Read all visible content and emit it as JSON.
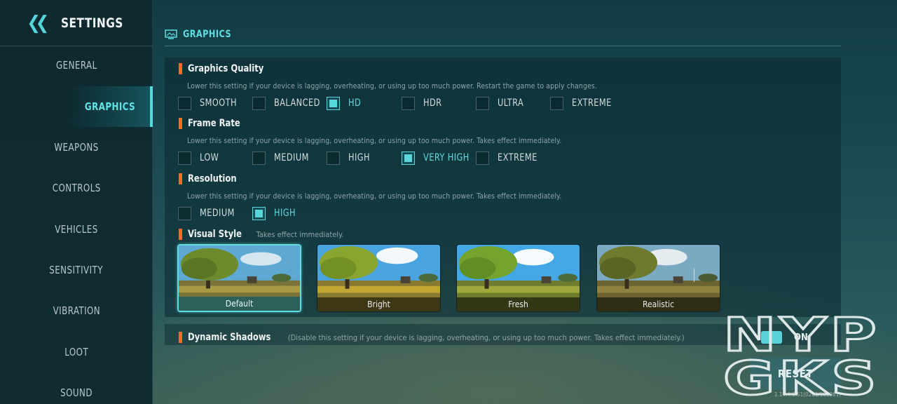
{
  "sidebar": {
    "title": "SETTINGS",
    "items": [
      {
        "label": "GENERAL"
      },
      {
        "label": "GRAPHICS",
        "active": true
      },
      {
        "label": "WEAPONS"
      },
      {
        "label": "CONTROLS"
      },
      {
        "label": "VEHICLES"
      },
      {
        "label": "SENSITIVITY"
      },
      {
        "label": "VIBRATION"
      },
      {
        "label": "LOOT"
      },
      {
        "label": "SOUND"
      }
    ]
  },
  "section": {
    "title": "GRAPHICS"
  },
  "graphics_quality": {
    "title": "Graphics Quality",
    "description": "Lower this setting if your device is lagging, overheating, or using up too much power. Restart the game to apply changes.",
    "options": [
      "SMOOTH",
      "BALANCED",
      "HD",
      "HDR",
      "ULTRA",
      "EXTREME"
    ],
    "selected": "HD"
  },
  "frame_rate": {
    "title": "Frame Rate",
    "description": "Lower this setting if your device is lagging, overheating, or using up too much power. Takes effect immediately.",
    "options": [
      "LOW",
      "MEDIUM",
      "HIGH",
      "VERY HIGH",
      "EXTREME"
    ],
    "selected": "VERY HIGH"
  },
  "resolution": {
    "title": "Resolution",
    "description": "Lower this setting if your device is lagging, overheating, or using up too much power. Takes effect immediately.",
    "options": [
      "MEDIUM",
      "HIGH"
    ],
    "selected": "HIGH"
  },
  "visual_style": {
    "title": "Visual Style",
    "note": "Takes effect immediately.",
    "options": [
      "Default",
      "Bright",
      "Fresh",
      "Realistic"
    ],
    "selected": "Default"
  },
  "dynamic_shadows": {
    "title": "Dynamic Shadows",
    "note": "(Disable this setting if your device is lagging, overheating, or using up too much power. Takes effect immediately.)",
    "state": "ON"
  },
  "reset_label": "RESET",
  "version": "1.14.4.6.51(0261/101261)",
  "watermark": {
    "line1": "NYP",
    "line2": "GKS"
  },
  "colors": {
    "accent": "#5fdde0",
    "marker": "#ff6a2a",
    "panel": "#0a2830"
  }
}
